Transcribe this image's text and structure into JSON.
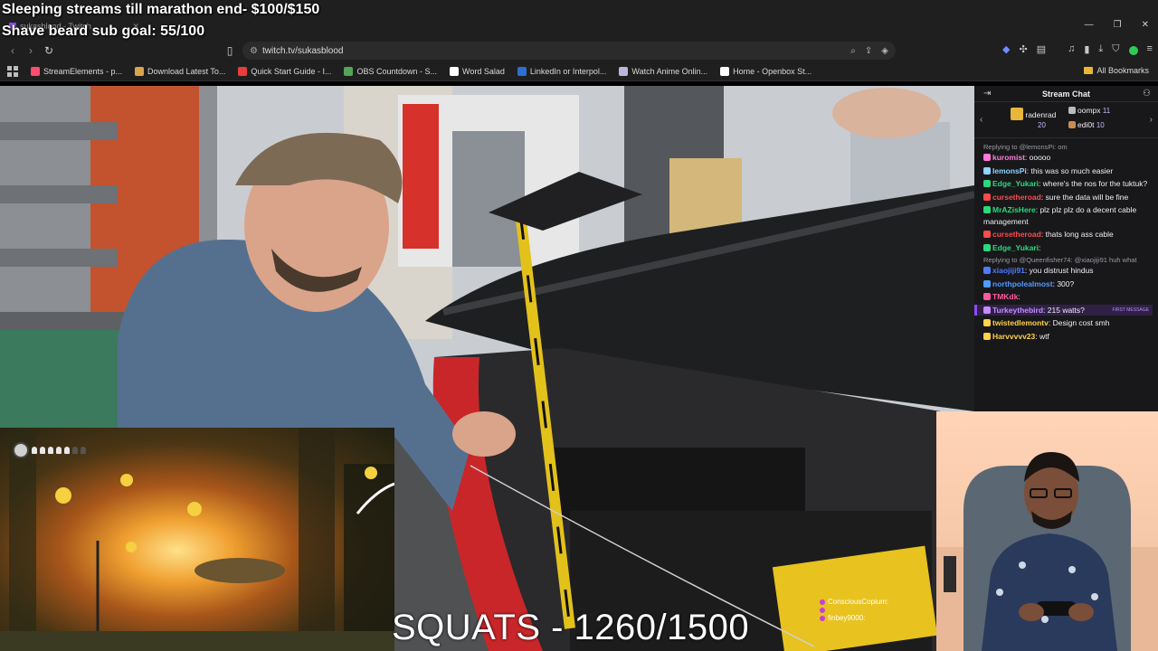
{
  "overlay": {
    "goal_line_1": "Sleeping streams till marathon end- $100/$150",
    "goal_line_2": "Shave beard sub goal: 55/100",
    "squats": "SQUATS - 1260/1500",
    "viewer_names": [
      "ConsciousCopium:",
      "",
      "finbey9000:"
    ]
  },
  "browser": {
    "tab_title": "sukasblood - Twitch",
    "url": "twitch.tv/sukasblood",
    "bookmarks": [
      {
        "label": "StreamElements - p...",
        "color": "#ff4b6e"
      },
      {
        "label": "Download Latest To...",
        "color": "#d9a54a"
      },
      {
        "label": "Quick Start Guide - I...",
        "color": "#e83d3d"
      },
      {
        "label": "OBS Countdown - S...",
        "color": "#56a35a"
      },
      {
        "label": "Word Salad",
        "color": "#ffffff"
      },
      {
        "label": "LinkedIn or Interpol...",
        "color": "#2e6fd1"
      },
      {
        "label": "Watch Anime Onlin...",
        "color": "#b8b8d8"
      },
      {
        "label": "Home - Openbox St...",
        "color": "#ffffff"
      }
    ],
    "all_bookmarks": "All Bookmarks"
  },
  "chat": {
    "title": "Stream Chat",
    "gifters": [
      {
        "name": "radenrad",
        "count": "20"
      },
      {
        "name": "oompx",
        "count": "11"
      },
      {
        "name": "edi0t",
        "count": "10"
      }
    ],
    "messages": [
      {
        "reply": "Replying to @lemonsPi: om",
        "user": "",
        "text": "",
        "color": ""
      },
      {
        "reply": "",
        "user": "kuromist",
        "text": ": ooooo",
        "color": "#ff7ad9"
      },
      {
        "reply": "",
        "user": "lemonsPi",
        "text": ": this was so much easier",
        "color": "#8fd3ff"
      },
      {
        "reply": "",
        "user": "Edge_Yukari",
        "text": ": where's the nos for the tuktuk?",
        "color": "#2bd97a"
      },
      {
        "reply": "",
        "user": "cursetheroad",
        "text": ": sure the data will be fine",
        "color": "#ff4a4a"
      },
      {
        "reply": "",
        "user": "MrAZisHere",
        "text": ": plz plz plz do a decent cable management",
        "color": "#2bd97a"
      },
      {
        "reply": "",
        "user": "cursetheroad",
        "text": ": thats long ass cable",
        "color": "#ff4a4a"
      },
      {
        "reply": "",
        "user": "Edge_Yukari",
        "text": ":",
        "color": "#2bd97a"
      },
      {
        "reply": "Replying to @Queenfisher74: @xiaojiji91 huh what",
        "user": "",
        "text": "",
        "color": ""
      },
      {
        "reply": "",
        "user": "xiaojiji91",
        "text": ": you distrust hindus",
        "color": "#4f7bff"
      },
      {
        "reply": "",
        "user": "northpolealmost",
        "text": ": 300?",
        "color": "#4f9bff"
      },
      {
        "reply": "",
        "user": "TMKdk",
        "text": ":",
        "color": "#ff5aa0"
      },
      {
        "reply": "",
        "user": "Turkeythebird",
        "text": ": 215 watts?",
        "color": "#c78bff",
        "tag": "FIRST MESSAGE"
      },
      {
        "reply": "",
        "user": "twistedlemontv",
        "text": ": Design cost smh",
        "color": "#ffd24a"
      },
      {
        "reply": "",
        "user": "Harvvvvv23",
        "text": ": wtf",
        "color": "#ffd24a"
      }
    ]
  },
  "colors": {
    "twitch_purple": "#9147ff",
    "chat_bg": "#18181b"
  }
}
